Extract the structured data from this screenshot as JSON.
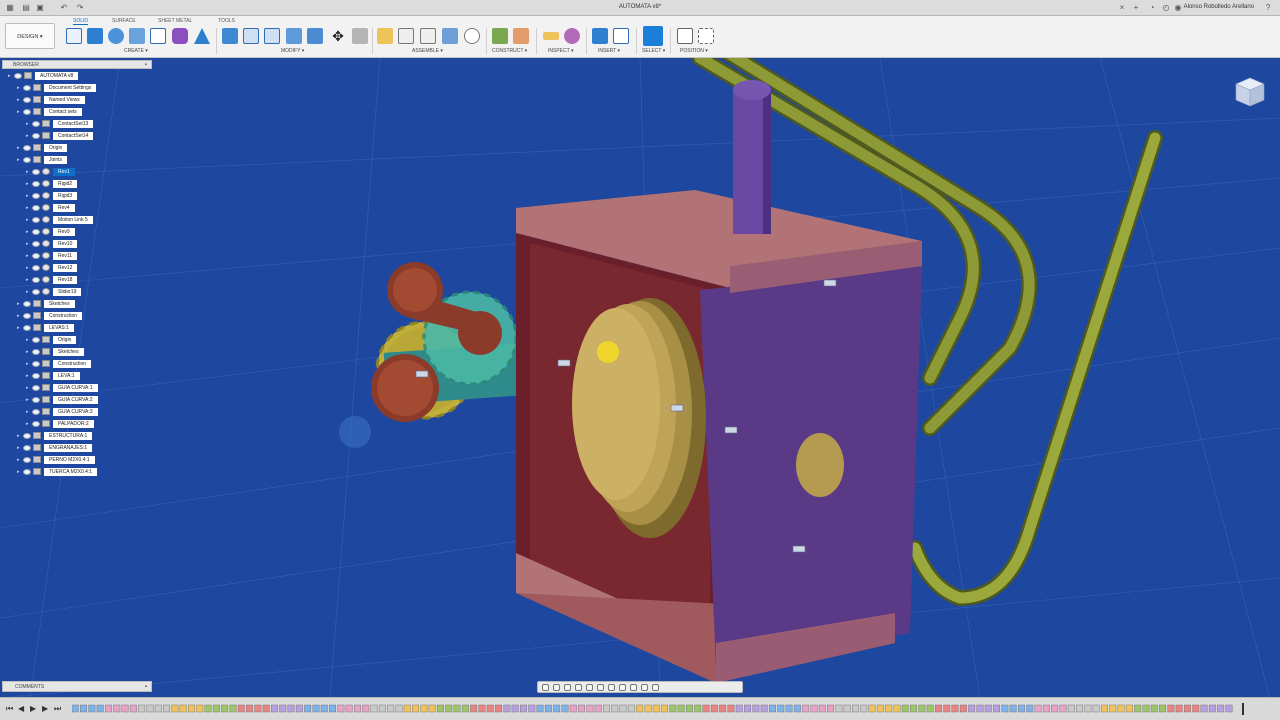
{
  "app": {
    "title": "AUTOMATA v8*",
    "user": "Alonso Robolledo Arellano"
  },
  "ribbon": {
    "workspace": "DESIGN ▾",
    "tabs": [
      "SOLID",
      "SURFACE",
      "SHEET METAL",
      "TOOLS"
    ],
    "groups": [
      "CREATE ▾",
      "MODIFY ▾",
      "ASSEMBLE ▾",
      "CONSTRUCT ▾",
      "INSPECT ▾",
      "INSERT ▾",
      "SELECT ▾",
      "POSITION ▾"
    ]
  },
  "browser": {
    "title": "BROWSER",
    "items": [
      {
        "label": "AUTOMATA v8",
        "depth": 0,
        "icon": "doc"
      },
      {
        "label": "Document Settings",
        "depth": 1,
        "icon": "gear"
      },
      {
        "label": "Named Views",
        "depth": 1,
        "icon": "folder"
      },
      {
        "label": "Contact  sets",
        "depth": 1,
        "icon": "folder"
      },
      {
        "label": "ContactSet13",
        "depth": 2,
        "icon": "contact"
      },
      {
        "label": "ContactSet14",
        "depth": 2,
        "icon": "contact"
      },
      {
        "label": "Origin",
        "depth": 1,
        "icon": "folder"
      },
      {
        "label": "Joints",
        "depth": 1,
        "icon": "folder"
      },
      {
        "label": "Rev1",
        "depth": 2,
        "icon": "joint",
        "selected": true
      },
      {
        "label": "Rigid2",
        "depth": 2,
        "icon": "joint"
      },
      {
        "label": "Rigid3",
        "depth": 2,
        "icon": "joint"
      },
      {
        "label": "Rev4",
        "depth": 2,
        "icon": "joint"
      },
      {
        "label": "Motion Link 5",
        "depth": 2,
        "icon": "joint"
      },
      {
        "label": "Rev9",
        "depth": 2,
        "icon": "joint"
      },
      {
        "label": "Rev10",
        "depth": 2,
        "icon": "joint"
      },
      {
        "label": "Rev11",
        "depth": 2,
        "icon": "joint"
      },
      {
        "label": "Rev12",
        "depth": 2,
        "icon": "joint"
      },
      {
        "label": "Rev18",
        "depth": 2,
        "icon": "joint"
      },
      {
        "label": "Slider19",
        "depth": 2,
        "icon": "joint"
      },
      {
        "label": "Sketches",
        "depth": 1,
        "icon": "folder"
      },
      {
        "label": "Construction",
        "depth": 1,
        "icon": "folder"
      },
      {
        "label": "LEVAS:1",
        "depth": 1,
        "icon": "component"
      },
      {
        "label": "Origin",
        "depth": 2,
        "icon": "folder"
      },
      {
        "label": "Sketches",
        "depth": 2,
        "icon": "folder"
      },
      {
        "label": "Construction",
        "depth": 2,
        "icon": "folder"
      },
      {
        "label": "LEVA:1",
        "depth": 2,
        "icon": "body"
      },
      {
        "label": "GUIA CURVA:1",
        "depth": 2,
        "icon": "body"
      },
      {
        "label": "GUIA CURVA:2",
        "depth": 2,
        "icon": "body"
      },
      {
        "label": "GUIA CURVA:3",
        "depth": 2,
        "icon": "body"
      },
      {
        "label": "PALPADOR:2",
        "depth": 2,
        "icon": "body"
      },
      {
        "label": "ESTRUCTURA:1",
        "depth": 1,
        "icon": "component"
      },
      {
        "label": "ENGRANAJES:1",
        "depth": 1,
        "icon": "component"
      },
      {
        "label": "PERNO M2X0.4:1",
        "depth": 1,
        "icon": "component"
      },
      {
        "label": "TUERCA M2X0.4:1",
        "depth": 1,
        "icon": "component"
      }
    ]
  },
  "comments": {
    "title": "COMMENTS"
  },
  "colors": {
    "viewport_bg": "#1e47a0",
    "selection": "#0f6fc6",
    "box_top": "#a86a6c",
    "box_side": "#5c3d86",
    "cam": "#bfa45a",
    "rail": "#7d8b2e"
  }
}
